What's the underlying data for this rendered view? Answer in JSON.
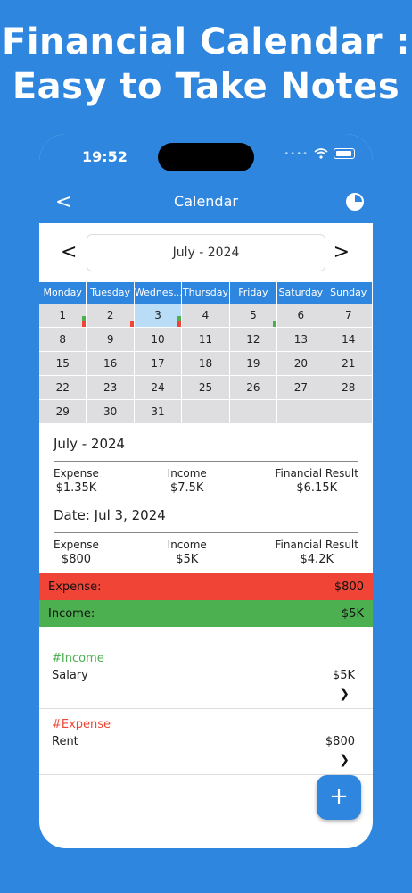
{
  "promo": {
    "line1": "Financial Calendar :",
    "line2": "Easy to Take Notes"
  },
  "status": {
    "time": "19:52",
    "dots": "••••"
  },
  "nav": {
    "title": "Calendar",
    "back": "<"
  },
  "month": {
    "label": "July - 2024",
    "prev": "<",
    "next": ">"
  },
  "weekdays": [
    "Monday",
    "Tuesday",
    "Wednes...",
    "Thursday",
    "Friday",
    "Saturday",
    "Sunday"
  ],
  "days": [
    "1",
    "2",
    "3",
    "4",
    "5",
    "6",
    "7",
    "8",
    "9",
    "10",
    "11",
    "12",
    "13",
    "14",
    "15",
    "16",
    "17",
    "18",
    "19",
    "20",
    "21",
    "22",
    "23",
    "24",
    "25",
    "26",
    "27",
    "28",
    "29",
    "30",
    "31",
    "",
    "",
    "",
    ""
  ],
  "selected_day": "3",
  "colors": {
    "primary": "#2f86de",
    "expense": "#ef4436",
    "income": "#4caf50"
  },
  "month_summary": {
    "title": "July - 2024",
    "expense_label": "Expense",
    "expense": "$1.35K",
    "income_label": "Income",
    "income": "$7.5K",
    "result_label": "Financial Result",
    "result": "$6.15K"
  },
  "date_summary": {
    "title": "Date: Jul 3, 2024",
    "expense_label": "Expense",
    "expense": "$800",
    "income_label": "Income",
    "income": "$5K",
    "result_label": "Financial Result",
    "result": "$4.2K"
  },
  "totals": {
    "expense_label": "Expense:",
    "expense": "$800",
    "income_label": "Income:",
    "income": "$5K"
  },
  "entries": [
    {
      "tag": "#Income",
      "name": "Salary",
      "amount": "$5K"
    },
    {
      "tag": "#Expense",
      "name": "Rent",
      "amount": "$800"
    }
  ],
  "fab": "+"
}
